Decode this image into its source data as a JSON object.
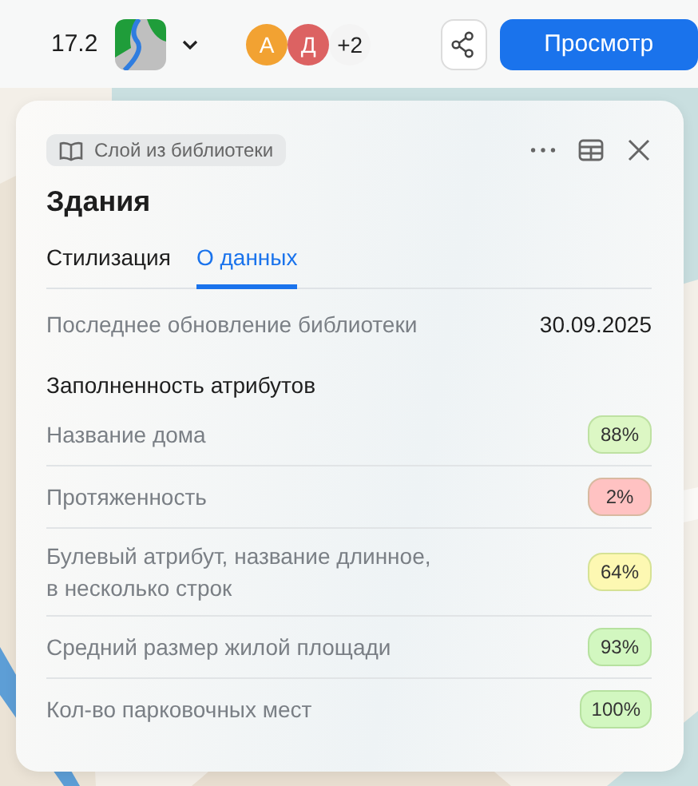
{
  "toolbar": {
    "zoom": "17.2",
    "avatars": [
      {
        "letter": "А",
        "color": "#f2a232"
      },
      {
        "letter": "Д",
        "color": "#dc6262"
      }
    ],
    "more_users": "+2",
    "view_button": "Просмотр"
  },
  "panel": {
    "badge": "Слой из библиотеки",
    "title": "Здания",
    "tabs": [
      {
        "label": "Стилизация",
        "selected": false
      },
      {
        "label": "О данных",
        "selected": true
      }
    ],
    "updated_label": "Последнее обновление библиотеки",
    "updated_value": "30.09.2025",
    "section_title": "Заполненность атрибутов",
    "attributes": [
      {
        "name": "Название дома",
        "value": "88%",
        "color": "#dcf7c4"
      },
      {
        "name": "Протяженность",
        "value": "2%",
        "color": "#ffc2c2"
      },
      {
        "name": "Булевый атрибут, название длинное, в несколько строк",
        "value": "64%",
        "color": "#fdf8b2"
      },
      {
        "name": "Средний размер жилой площади",
        "value": "93%",
        "color": "#d2f7c0"
      },
      {
        "name": "Кол-во парковочных мест",
        "value": "100%",
        "color": "#d2f7c0"
      }
    ]
  }
}
